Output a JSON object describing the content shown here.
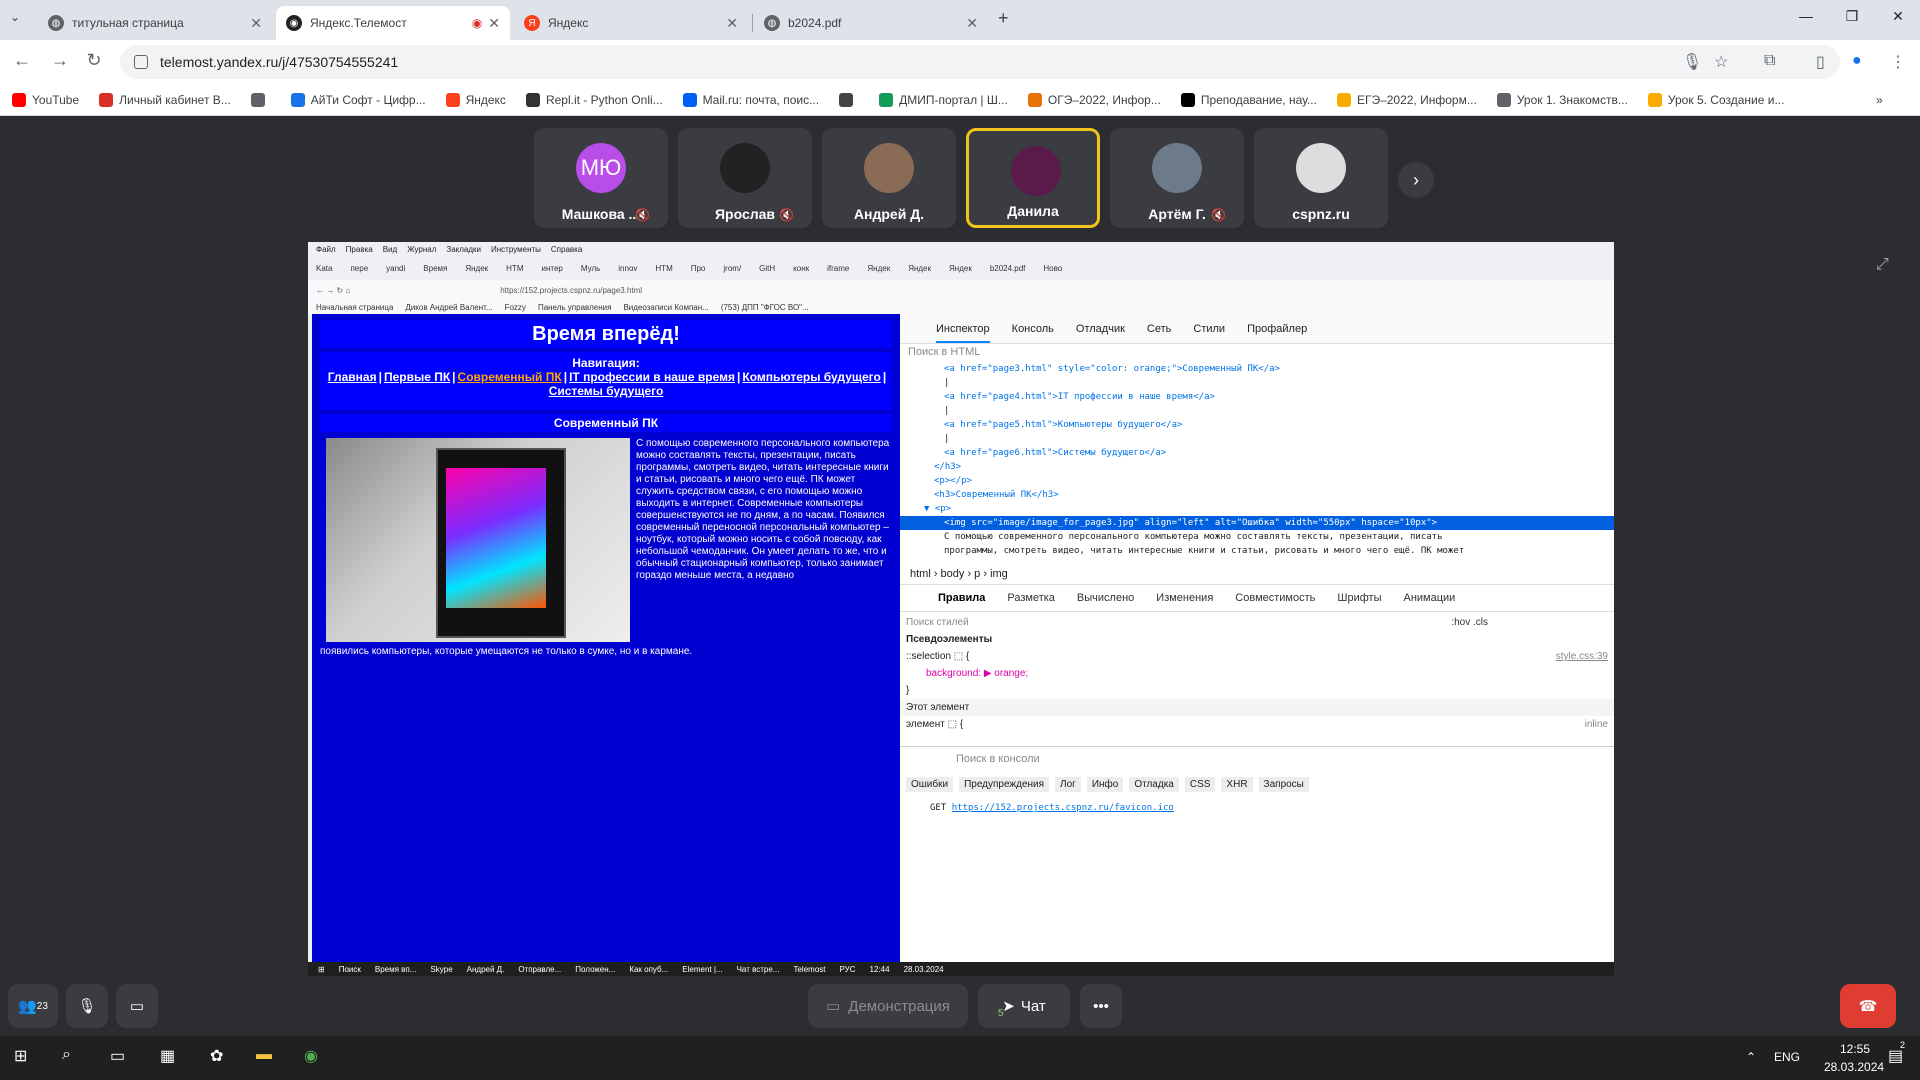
{
  "browser": {
    "tabs": [
      {
        "title": "титульная страница",
        "favicon": "globe-icon",
        "active": false
      },
      {
        "title": "Яндекс.Телемост",
        "favicon": "telemost-icon",
        "active": true
      },
      {
        "title": "Яндекс",
        "favicon": "yandex-icon",
        "active": false
      },
      {
        "title": "b2024.pdf",
        "favicon": "globe-icon",
        "active": false
      }
    ],
    "new_tab": "+",
    "url": "telemost.yandex.ru/j/47530754555241",
    "bookmarks": [
      {
        "label": "YouTube",
        "color": "#ff0000"
      },
      {
        "label": "Личный кабинет В...",
        "color": "#d93025"
      },
      {
        "label": "",
        "color": "#5f6368"
      },
      {
        "label": "АйТи Софт - Цифр...",
        "color": "#1a73e8"
      },
      {
        "label": "Яндекс",
        "color": "#fc3f1d"
      },
      {
        "label": "Repl.it - Python Onli...",
        "color": "#333333"
      },
      {
        "label": "Mail.ru: почта, поис...",
        "color": "#005ff9"
      },
      {
        "label": "",
        "color": "#444444"
      },
      {
        "label": "ДМИП-портал | Ш...",
        "color": "#0f9d58"
      },
      {
        "label": "ОГЭ–2022, Инфор...",
        "color": "#e8710a"
      },
      {
        "label": "Преподавание, нау...",
        "color": "#000000"
      },
      {
        "label": "ЕГЭ–2022, Информ...",
        "color": "#f9ab00"
      },
      {
        "label": "Урок 1. Знакомств...",
        "color": "#5f6368"
      },
      {
        "label": "Урок 5. Создание и...",
        "color": "#f9ab00"
      }
    ],
    "more_bookmarks": "»"
  },
  "participants": [
    {
      "name": "Машкова ...",
      "initials": "МЮ",
      "color": "#b84de8",
      "muted": true,
      "active": false
    },
    {
      "name": "Ярослав",
      "initials": "",
      "color": "#222222",
      "muted": true,
      "active": false
    },
    {
      "name": "Андрей Д.",
      "initials": "",
      "color": "#8a6b55",
      "muted": false,
      "active": false
    },
    {
      "name": "Данила",
      "initials": "",
      "color": "#5a1a4a",
      "muted": false,
      "active": true
    },
    {
      "name": "Артём Г.",
      "initials": "",
      "color": "#6d7a8a",
      "muted": true,
      "active": false
    },
    {
      "name": "cspnz.ru",
      "initials": "",
      "color": "#dddddd",
      "muted": false,
      "active": false
    }
  ],
  "next_arrow": "›",
  "shared": {
    "menu": [
      "Файл",
      "Правка",
      "Вид",
      "Журнал",
      "Закладки",
      "Инструменты",
      "Справка"
    ],
    "tabs": [
      "Kata",
      "пере",
      "yandi",
      "Время",
      "Яндек",
      "HTM",
      "интер",
      "Муль",
      "innov",
      "HTM",
      "Про",
      "jrom/",
      "GitH",
      "конк",
      "iframe",
      "Яндек",
      "Яндек",
      "Яндек",
      "b2024.pdf",
      "Ново"
    ],
    "url": "https://152.projects.cspnz.ru/page3.html",
    "bookmarks": [
      "Начальная страница",
      "Диков Андрей Валент...",
      "Fozzy",
      "Панель управления",
      "Видеозаписи Компан...",
      "(753) ДПП \"ФГОС ВО\"..."
    ],
    "page": {
      "title": "Время вперёд!",
      "nav_heading": "Навигация:",
      "nav_links": [
        "Главная",
        "Первые ПК",
        "Современный ПК",
        "IT профессии в наше время",
        "Компьютеры будущего",
        "Системы будущего"
      ],
      "section": "Современный ПК",
      "body": "С помощью современного персонального компьютера можно составлять тексты, презентации, писать программы, смотреть видео, читать интересные книги и статьи, рисовать и много чего ещё. ПК может служить средством связи, с его помощью можно выходить в интернет. Современные компьютеры совершенствуются не по дням, а по часам. Появился современный переносной персональный компьютер – ноутбук, который можно носить с собой повсюду, как небольшой чемоданчик. Он умеет делать то же, что и обычный стационарный компьютер, только занимает гораздо меньше места, а недавно",
      "tail": "появились компьютеры, которые умещаются не только в сумке, но и в кармане."
    },
    "devtools": {
      "tabs": [
        "Инспектор",
        "Консоль",
        "Отладчик",
        "Сеть",
        "Стили",
        "Профайлер"
      ],
      "search_placeholder": "Поиск в HTML",
      "code": [
        "<a href=\"page3.html\" style=\"color: orange;\">Современный ПК</a>",
        "|",
        "<a href=\"page4.html\">IT профессии в наше время</a>",
        "|",
        "<a href=\"page5.html\">Компьютеры будущего</a>",
        "|",
        "<a href=\"page6.html\">Системы будущего</a>",
        "</h3>",
        "<p></p>",
        "<h3>Современный ПК</h3>",
        "▼ <p>",
        "<img src=\"image/image_for_page3.jpg\" align=\"left\" alt=\"Ошибка\" width=\"550px\" hspace=\"10px\">",
        "С помощью современного персонального компьютера можно составлять тексты, презентации, писать",
        "программы, смотреть видео, читать интересные книги и статьи, рисовать и много чего ещё. ПК может"
      ],
      "breadcrumbs": "html › body › p › img",
      "rule_tabs": [
        "Правила",
        "Разметка",
        "Вычислено",
        "Изменения",
        "Совместимость",
        "Шрифты",
        "Анимации"
      ],
      "styles_search": "Поиск стилей",
      "styles_tools": ":hov .cls",
      "pseudo": "Псевдоэлементы",
      "selection_rule": "::selection ⬚ {",
      "selection_src": "style.css:39",
      "background_decl": "background: ▶ orange;",
      "close_brace": "}",
      "this_element": "Этот элемент",
      "element_rule": "элемент ⬚ {",
      "inline": "inline",
      "console_search": "Поиск в консоли",
      "console_chips": [
        "Ошибки",
        "Предупреждения",
        "Лог",
        "Инфо",
        "Отладка",
        "CSS",
        "XHR",
        "Запросы"
      ],
      "get_method": "GET",
      "get_url": "https://152.projects.cspnz.ru/favicon.ico"
    },
    "taskbar": [
      "Поиск",
      "Время вп...",
      "Skype",
      "Андрей Д.",
      "Отправле...",
      "Положен...",
      "Как опуб...",
      "Element |...",
      "Чат встре...",
      "Telemost",
      "РУС",
      "12:44",
      "28.03.2024"
    ]
  },
  "controls": {
    "demo": "Демонстрация",
    "chat": "Чат",
    "chat_badge": "5",
    "more": "•••",
    "people_count": "23"
  },
  "windows": {
    "lang": "ENG",
    "time": "12:55",
    "date": "28.03.2024",
    "notif": "2"
  }
}
